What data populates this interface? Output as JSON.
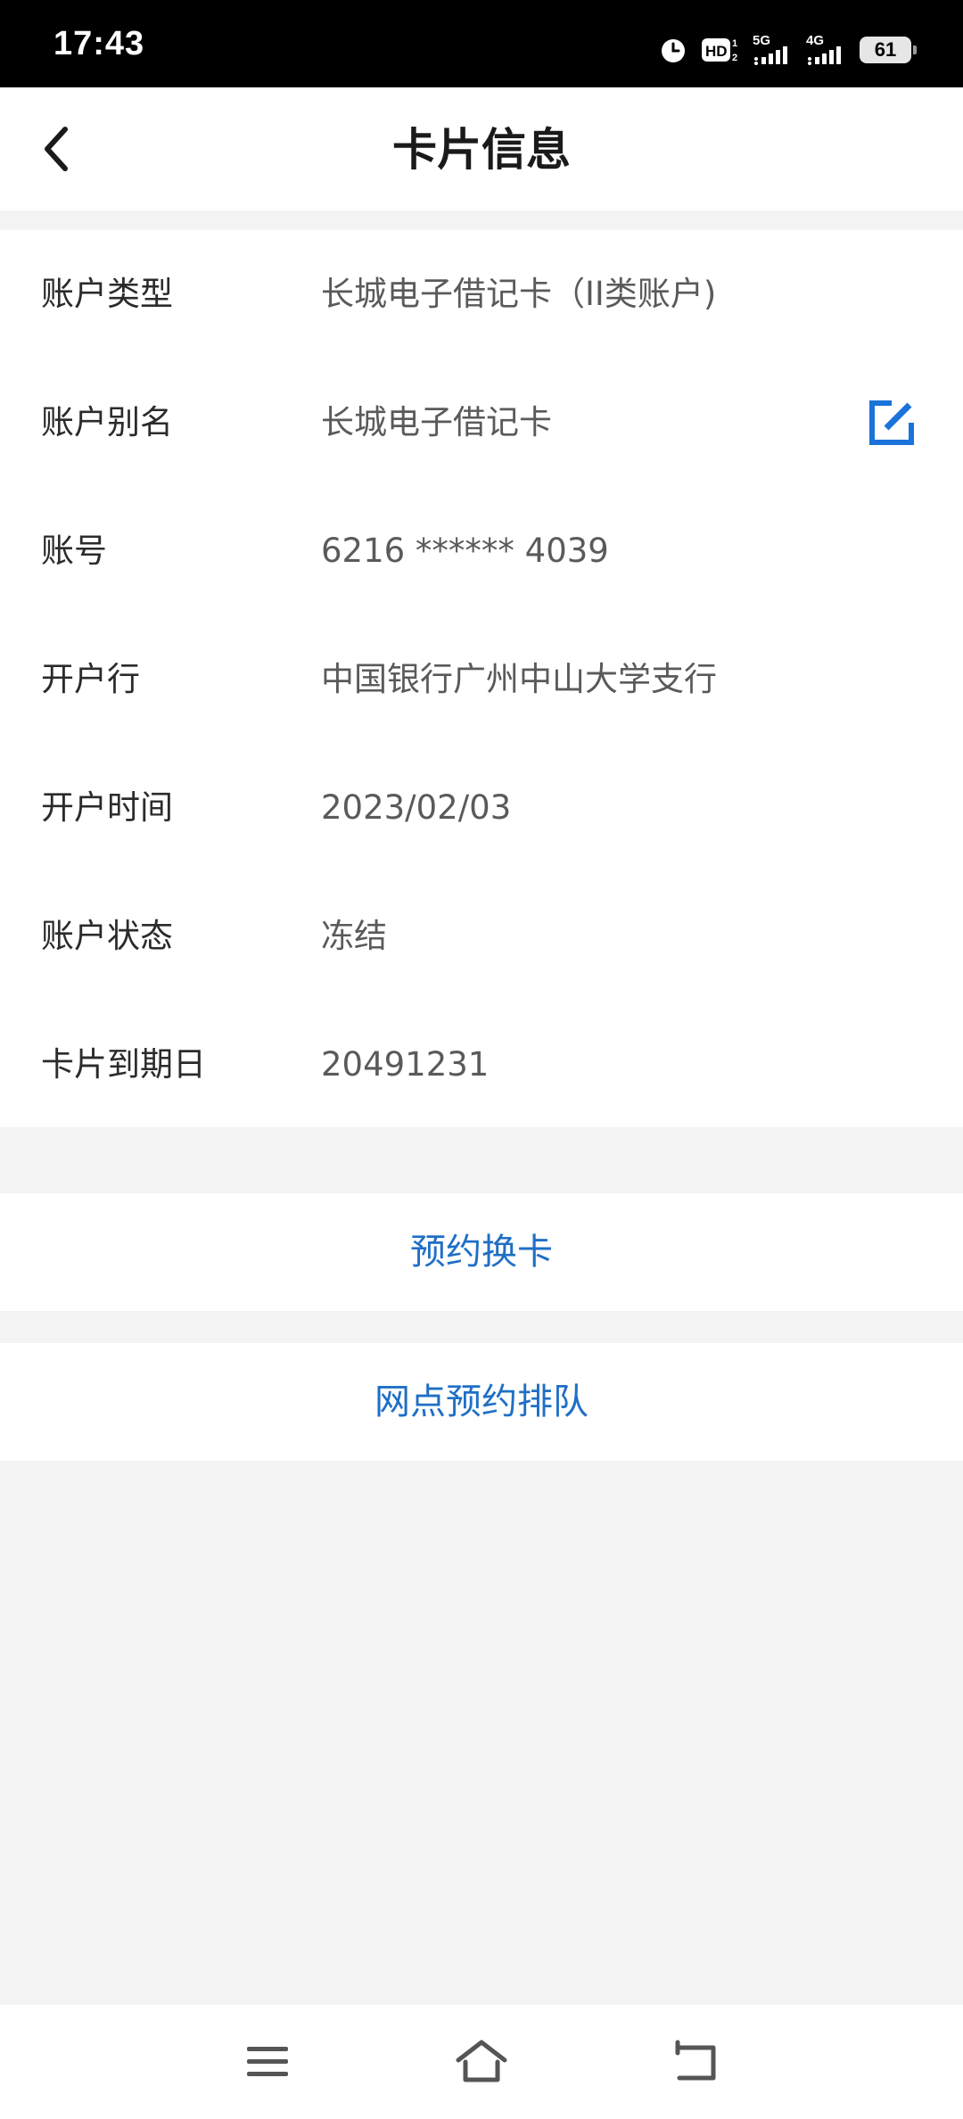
{
  "status_bar": {
    "time": "17:43",
    "net_5g": "5G",
    "net_4g": "4G",
    "battery": "61",
    "icons": [
      "alarm-icon",
      "hd-icon",
      "signal-icon",
      "signal-icon",
      "battery-icon"
    ]
  },
  "header": {
    "title": "卡片信息",
    "back_icon": "chevron-left-icon"
  },
  "info": {
    "rows": [
      {
        "label": "账户类型",
        "value": "长城电子借记卡（II类账户)"
      },
      {
        "label": "账户别名",
        "value": "长城电子借记卡"
      },
      {
        "label": "账号",
        "value": "6216 ****** 4039"
      },
      {
        "label": "开户行",
        "value": "中国银行广州中山大学支行"
      },
      {
        "label": "开户时间",
        "value": "2023/02/03"
      },
      {
        "label": "账户状态",
        "value": "冻结"
      },
      {
        "label": "卡片到期日",
        "value": "20491231"
      }
    ],
    "edit_icon": "edit-icon"
  },
  "actions": {
    "replace_card": "预约换卡",
    "branch_queue": "网点预约排队"
  },
  "nav": {
    "icons": [
      "menu-icon",
      "home-icon",
      "back-icon"
    ]
  },
  "colors": {
    "accent": "#1f6fc5",
    "edit_icon": "#1a73d9",
    "background": "#f3f3f3"
  }
}
